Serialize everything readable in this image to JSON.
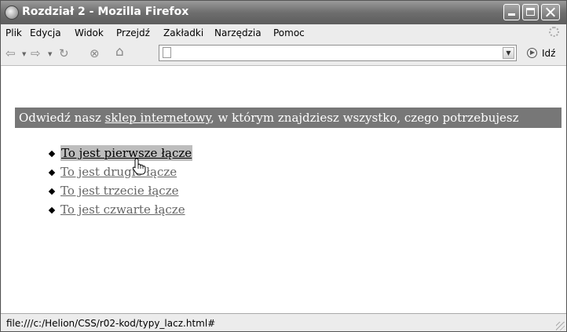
{
  "window": {
    "title": "Rozdział 2 - Mozilla Firefox"
  },
  "menu": [
    {
      "label": "Plik"
    },
    {
      "label": "Edycja"
    },
    {
      "label": "Widok"
    },
    {
      "label": "Przejdź"
    },
    {
      "label": "Zakładki"
    },
    {
      "label": "Narzędzia"
    },
    {
      "label": "Pomoc"
    }
  ],
  "toolbar": {
    "url": "",
    "go_label": "Idź"
  },
  "page": {
    "banner": {
      "before": "Odwiedź nasz ",
      "link": "sklep internetowy",
      "after": ", w którym znajdziesz wszystko, czego potrzebujesz"
    },
    "links": [
      {
        "label": "To jest pierwsze łącze",
        "state": "hover"
      },
      {
        "label": "To jest drugie łącze",
        "state": "normal"
      },
      {
        "label": "To jest trzecie łącze",
        "state": "normal"
      },
      {
        "label": "To jest czwarte łącze",
        "state": "normal"
      }
    ]
  },
  "status": {
    "text": "file:///c:/Helion/CSS/r02-kod/typy_lacz.html#"
  },
  "colors": {
    "banner_bg": "#777777",
    "link": "#666666",
    "hover_bg": "#bdbdbd"
  }
}
